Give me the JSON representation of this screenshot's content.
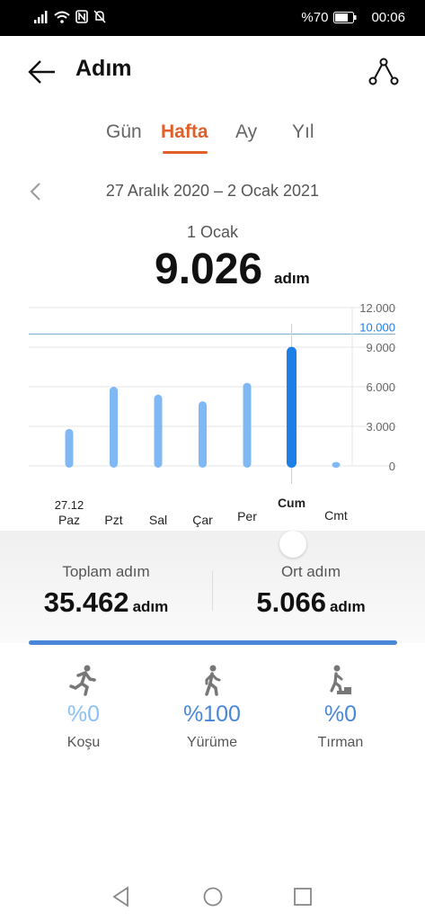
{
  "status_bar": {
    "battery": "%70",
    "time": "00:06"
  },
  "header": {
    "title": "Adım"
  },
  "tabs": [
    {
      "label": "Gün"
    },
    {
      "label": "Hafta"
    },
    {
      "label": "Ay"
    },
    {
      "label": "Yıl"
    }
  ],
  "range": {
    "label": "27 Aralık 2020 – 2 Ocak 2021"
  },
  "selected": {
    "date": "1 Ocak",
    "value": "9.026",
    "unit": "adım"
  },
  "chart_data": {
    "type": "bar",
    "categories": [
      "Paz",
      "Pzt",
      "Sal",
      "Çar",
      "Per",
      "Cum",
      "Cmt"
    ],
    "first_date_label": "27.12",
    "values": [
      2800,
      6000,
      5400,
      4900,
      6300,
      9026,
      300
    ],
    "selected_index": 5,
    "ylim": [
      0,
      12000
    ],
    "yticks": [
      "12.000",
      "9.000",
      "6.000",
      "3.000",
      "0"
    ],
    "ytick_values": [
      12000,
      9000,
      6000,
      3000,
      0
    ],
    "goal": 10000,
    "goal_label": "10.000",
    "colors": {
      "bar": "#7fb8f3",
      "selected_bar": "#1e7ee8",
      "goal": "#6fa8c8"
    }
  },
  "stats": {
    "total_label": "Toplam adım",
    "total_value": "35.462",
    "total_unit": "adım",
    "avg_label": "Ort adım",
    "avg_value": "5.066",
    "avg_unit": "adım"
  },
  "activities": [
    {
      "name": "Koşu",
      "percent": "%0",
      "icon": "running-icon",
      "color": "#8cc0f0"
    },
    {
      "name": "Yürüme",
      "percent": "%100",
      "icon": "walking-icon",
      "color": "#4a87d8"
    },
    {
      "name": "Tırman",
      "percent": "%0",
      "icon": "climbing-icon",
      "color": "#4a87d8"
    }
  ]
}
